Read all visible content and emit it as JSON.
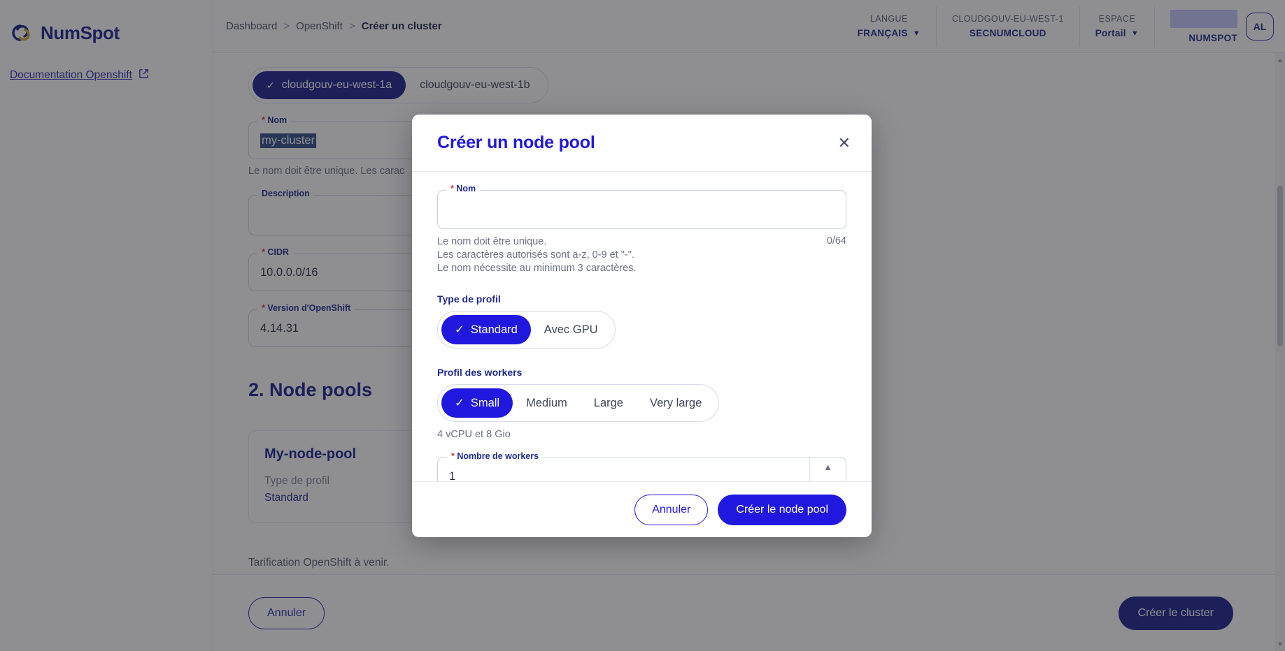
{
  "colors": {
    "brand_navy": "#1a1f8c",
    "brand_blue": "#2118e0",
    "accent_gold": "#d4a72c",
    "required_red": "#d23b2e",
    "muted_text": "#6a7086"
  },
  "sidebar": {
    "logo_text": "NumSpot",
    "doc_link": "Documentation Openshift"
  },
  "topbar": {
    "breadcrumb": [
      {
        "label": "Dashboard"
      },
      {
        "label": "OpenShift"
      },
      {
        "label": "Créer un cluster"
      }
    ],
    "separator": ">",
    "cells": [
      {
        "label": "LANGUE",
        "value": "FRANÇAIS",
        "has_chevron": true
      },
      {
        "label": "CLOUDGOUV-EU-WEST-1",
        "value": "SECNUMCLOUD",
        "has_chevron": false
      },
      {
        "label": "ESPACE",
        "value": "Portail",
        "has_chevron": true
      }
    ],
    "account": {
      "name": "NUMSPOT",
      "avatar_initials": "AL"
    }
  },
  "page": {
    "zones": {
      "options": [
        {
          "label": "cloudgouv-eu-west-1a",
          "selected": true
        },
        {
          "label": "cloudgouv-eu-west-1b",
          "selected": false
        }
      ]
    },
    "fields": [
      {
        "legend": "Nom",
        "required": true,
        "value": "my-cluster",
        "selected": true,
        "helper": "Le nom doit être unique. Les carac"
      },
      {
        "legend": "Description",
        "required": false,
        "value": "",
        "selected": false,
        "helper": ""
      },
      {
        "legend": "CIDR",
        "required": true,
        "value": "10.0.0.0/16",
        "selected": false,
        "helper": ""
      },
      {
        "legend": "Version d'OpenShift",
        "required": true,
        "value": "4.14.31",
        "selected": false,
        "helper": ""
      }
    ],
    "section_title": "2. Node pools",
    "node_pool_card": {
      "name": "My-node-pool",
      "key": "Type de profil",
      "value": "Standard"
    },
    "pricing_note": "Tarification OpenShift à venir.",
    "footer": {
      "cancel_label": "Annuler",
      "submit_label": "Créer le cluster"
    }
  },
  "modal": {
    "title": "Créer un node pool",
    "close_icon": "close-icon",
    "name_field": {
      "legend": "Nom",
      "required": true,
      "value": "",
      "helper_lines": [
        "Le nom doit être unique.",
        "Les caractères autorisés sont a-z, 0-9 et \"-\".",
        "Le nom nécessite au minimum 3 caractères."
      ],
      "counter": "0/64"
    },
    "profile_type": {
      "label": "Type de profil",
      "options": [
        {
          "label": "Standard",
          "selected": true
        },
        {
          "label": "Avec GPU",
          "selected": false
        }
      ]
    },
    "worker_profile": {
      "label": "Profil des workers",
      "options": [
        {
          "label": "Small",
          "selected": true
        },
        {
          "label": "Medium",
          "selected": false
        },
        {
          "label": "Large",
          "selected": false
        },
        {
          "label": "Very large",
          "selected": false
        }
      ],
      "note": "4 vCPU et 8 Gio"
    },
    "worker_count": {
      "legend": "Nombre de workers",
      "required": true,
      "value": "1"
    },
    "footer": {
      "cancel_label": "Annuler",
      "submit_label": "Créer le node pool"
    }
  }
}
